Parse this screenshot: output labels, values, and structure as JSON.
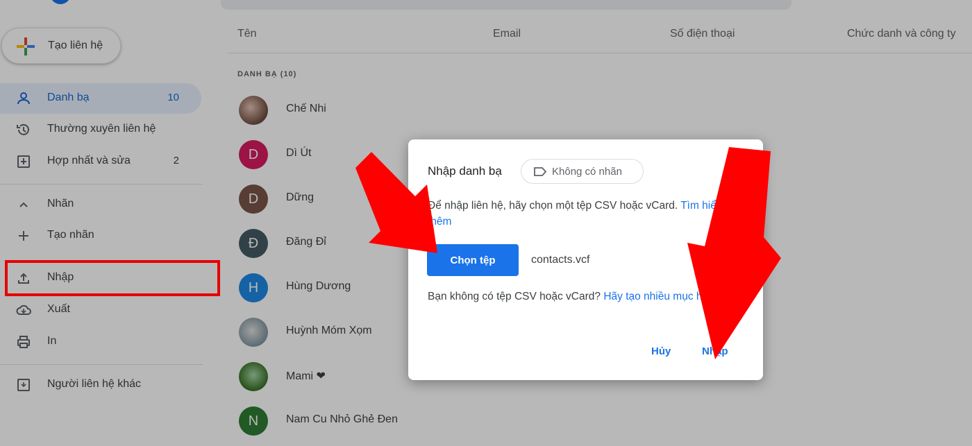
{
  "sidebar": {
    "create_label": "Tạo liên hệ",
    "items": [
      {
        "label": "Danh bạ",
        "count": "10",
        "icon": "person-icon"
      },
      {
        "label": "Thường xuyên liên hệ",
        "count": "",
        "icon": "history-icon"
      },
      {
        "label": "Hợp nhất và sửa",
        "count": "2",
        "icon": "merge-icon"
      },
      {
        "label": "Nhãn",
        "count": "",
        "icon": "chevron-up-icon"
      },
      {
        "label": "Tạo nhãn",
        "count": "",
        "icon": "plus-icon"
      },
      {
        "label": "Nhập",
        "count": "",
        "icon": "upload-icon"
      },
      {
        "label": "Xuất",
        "count": "",
        "icon": "cloud-download-icon"
      },
      {
        "label": "In",
        "count": "",
        "icon": "print-icon"
      },
      {
        "label": "Người liên hệ khác",
        "count": "",
        "icon": "archive-icon"
      }
    ]
  },
  "list": {
    "columns": [
      "Tên",
      "Email",
      "Số điện thoại",
      "Chức danh và công ty"
    ],
    "section_label": "DANH BẠ (10)",
    "contacts": [
      {
        "name": "Chế Nhi",
        "initial": "",
        "color": "#8d6e63"
      },
      {
        "name": "Dì Út",
        "initial": "D",
        "color": "#d81b60"
      },
      {
        "name": "Dững",
        "initial": "D",
        "color": "#795548"
      },
      {
        "name": "Đăng Đỉ",
        "initial": "Đ",
        "color": "#455a64"
      },
      {
        "name": "Hùng Dương",
        "initial": "H",
        "color": "#1e88e5"
      },
      {
        "name": "Huỳnh Móm Xọm",
        "initial": "",
        "color": "#9e9e9e"
      },
      {
        "name": "Mami ❤",
        "initial": "",
        "color": "#558b2f"
      },
      {
        "name": "Nam Cu Nhỏ Ghẻ Đen",
        "initial": "N",
        "color": "#2e7d32"
      }
    ]
  },
  "dialog": {
    "title": "Nhập danh bạ",
    "chip_label": "Không có nhãn",
    "description": "Để nhập liên hệ, hãy chọn một tệp CSV hoặc vCard.",
    "learn_more": "Tìm hiểu thêm",
    "choose_button": "Chọn tệp",
    "filename": "contacts.vcf",
    "note": "Bạn không có tệp CSV hoặc vCard?",
    "note_link": "Hãy tạo nhiều mục hệ.",
    "cancel": "Hủy",
    "import": "Nhập"
  },
  "colors": {
    "accent": "#1a73e8",
    "highlight": "#e50000",
    "arrow": "#ff0000"
  }
}
